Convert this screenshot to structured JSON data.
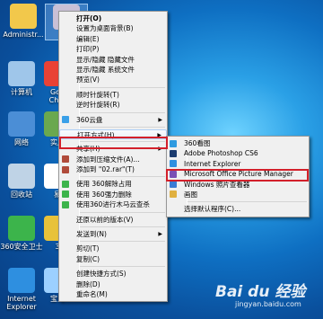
{
  "desktop": {
    "icons": [
      {
        "label": "Administr...",
        "color": "#f2c84b"
      },
      {
        "label": "65",
        "color": "#c9c0d6"
      },
      {
        "label": "计算机",
        "color": "#9fc6ea"
      },
      {
        "label": "Goo\nChro",
        "color": "#e94235"
      },
      {
        "label": "网络",
        "color": "#4b8ed6"
      },
      {
        "label": "实用",
        "color": "#6aa84f"
      },
      {
        "label": "回收站",
        "color": "#bfd3e6"
      },
      {
        "label": "易",
        "color": "#ffffff"
      },
      {
        "label": "360安全卫士",
        "color": "#3cb44b"
      },
      {
        "label": "3",
        "color": "#e8c23a"
      },
      {
        "label": "Internet\nExplorer",
        "color": "#2e8fe0"
      },
      {
        "label": "宝贝",
        "color": "#9cd0ff"
      }
    ]
  },
  "context_menu": {
    "items": [
      {
        "label": "打开(O)",
        "bold": true
      },
      {
        "label": "设置为桌面背景(B)"
      },
      {
        "label": "编辑(E)"
      },
      {
        "label": "打印(P)"
      },
      {
        "label": "显示/隐藏 隐藏文件"
      },
      {
        "label": "显示/隐藏 系统文件"
      },
      {
        "label": "预览(V)"
      },
      {
        "sep": true
      },
      {
        "label": "顺时针旋转(T)"
      },
      {
        "label": "逆时针旋转(R)"
      },
      {
        "sep": true
      },
      {
        "label": "360云盘",
        "submenu": true,
        "icon": "cloud-icon"
      },
      {
        "sep": true
      },
      {
        "label": "打开方式(H)",
        "submenu": true,
        "highlight": true
      },
      {
        "sep": true
      },
      {
        "label": "共享(H)",
        "submenu": true
      },
      {
        "label": "添加到压缩文件(A)...",
        "icon": "archive-icon"
      },
      {
        "label": "添加到 \"02.rar\"(T)",
        "icon": "archive-icon"
      },
      {
        "sep": true
      },
      {
        "label": "使用 360解除占用",
        "icon": "shield-icon"
      },
      {
        "label": "使用 360强力删除",
        "icon": "shield-icon"
      },
      {
        "label": "使用360进行木马云查杀",
        "icon": "shield-icon"
      },
      {
        "sep": true
      },
      {
        "label": "还原以前的版本(V)"
      },
      {
        "sep": true
      },
      {
        "label": "发送到(N)",
        "submenu": true
      },
      {
        "sep": true
      },
      {
        "label": "剪切(T)"
      },
      {
        "label": "复制(C)"
      },
      {
        "sep": true
      },
      {
        "label": "创建快捷方式(S)"
      },
      {
        "label": "删除(D)"
      },
      {
        "label": "重命名(M)"
      }
    ]
  },
  "open_with_menu": {
    "items": [
      {
        "label": "360看图",
        "icon_color": "#2f9be0"
      },
      {
        "label": "Adobe Photoshop CS6",
        "icon_color": "#1b3b6f"
      },
      {
        "label": "Internet Explorer",
        "icon_color": "#2e8fe0"
      },
      {
        "label": "Microsoft Office Picture Manager",
        "icon_color": "#7a4fb5",
        "boxed": true
      },
      {
        "label": "Windows 照片查看器",
        "icon_color": "#3a7bd5"
      },
      {
        "label": "画图",
        "icon_color": "#e0b040"
      },
      {
        "sep": true
      },
      {
        "label": "选择默认程序(C)..."
      }
    ]
  },
  "watermark": {
    "logo": "Bai du 经验",
    "url": "jingyan.baidu.com"
  },
  "colors": {
    "highlight_border": "#d3202b",
    "menu_bg": "#f0f0f0"
  }
}
